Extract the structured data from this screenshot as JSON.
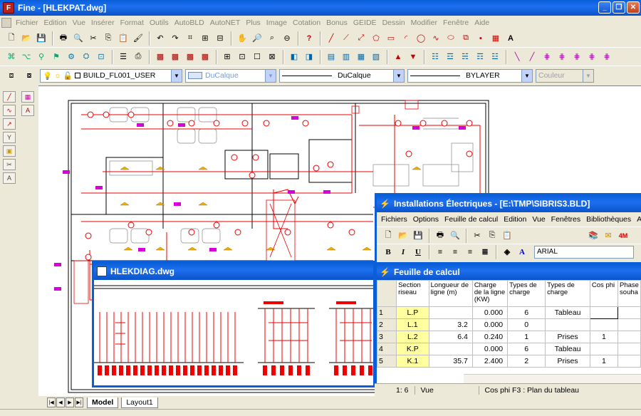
{
  "window": {
    "title": "Fine - [HLEKPAT.dwg]"
  },
  "menubar": [
    "Fichier",
    "Edition",
    "Vue",
    "Insérer",
    "Format",
    "Outils",
    "AutoBLD",
    "AutoNET",
    "Plus",
    "Image",
    "Cotation",
    "Bonus",
    "GEIDE",
    "Dessin",
    "Modifier",
    "Fenêtre",
    "Aide"
  ],
  "layers": {
    "layer_name": "BUILD_FL001_USER",
    "color_value": "DuCalque",
    "linetype_value": "DuCalque",
    "lineweight_value": "BYLAYER",
    "plotstyle_value": "Couleur"
  },
  "diagram_window": {
    "title": "HLEKDIAG.dwg"
  },
  "calc_app": {
    "title": "Installations Électriques - [E:\\TMP\\SIBRIS3.BLD]",
    "menu": [
      "Fichiers",
      "Options",
      "Feuille de calcul",
      "Edition",
      "Vue",
      "Fenêtres",
      "Bibliothèques",
      "Aide"
    ],
    "font_name": "ARIAL",
    "format_buttons": [
      "B",
      "I",
      "U"
    ]
  },
  "sheet": {
    "title": "Feuille de calcul",
    "columns": [
      "Section riseau",
      "Longueur de ligne (m)",
      "Charge de la ligne (KW)",
      "Types de charge",
      "Types de charge",
      "Cos phi",
      "Phase souha"
    ],
    "rows": [
      [
        "1",
        "L.P",
        "",
        "0.000",
        "6",
        "Tableau",
        ""
      ],
      [
        "2",
        "L.1",
        "3.2",
        "0.000",
        "0",
        "",
        ""
      ],
      [
        "3",
        "L.2",
        "6.4",
        "0.240",
        "1",
        "Prises",
        "1"
      ],
      [
        "4",
        "K.P",
        "",
        "0.000",
        "6",
        "Tableau",
        ""
      ],
      [
        "5",
        "K.1",
        "35.7",
        "2.400",
        "2",
        "Prises",
        "1"
      ]
    ]
  },
  "calc_status": {
    "pos": "1: 6",
    "mode": "Vue",
    "hint": "Cos phi F3 : Plan du tableau"
  },
  "layout_tabs": [
    "Model",
    "Layout1"
  ]
}
